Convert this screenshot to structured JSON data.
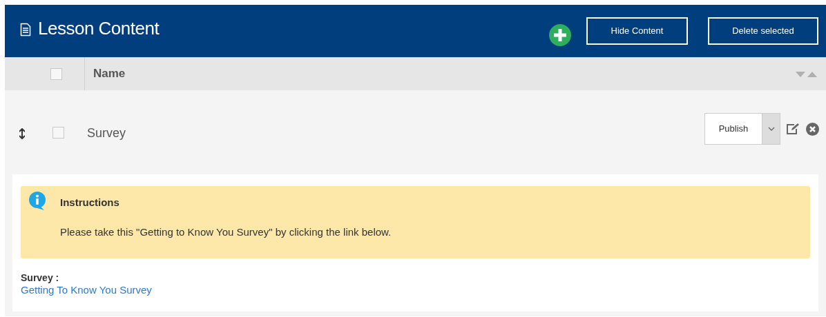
{
  "header": {
    "title": "Lesson Content",
    "buttons": [
      "Hide Content",
      "Delete selected"
    ]
  },
  "table": {
    "columns": [
      {
        "label": "Name"
      }
    ],
    "select_all": {
      "checked": false
    },
    "rows": [
      {
        "name": "Survey",
        "checked": false,
        "status": "Publish",
        "instructions": {
          "title": "Instructions",
          "text": "Please take this \"Getting to Know You Survey\" by clicking the link below."
        },
        "survey_label": "Survey :",
        "survey_link": "Getting To Know You Survey"
      }
    ]
  }
}
